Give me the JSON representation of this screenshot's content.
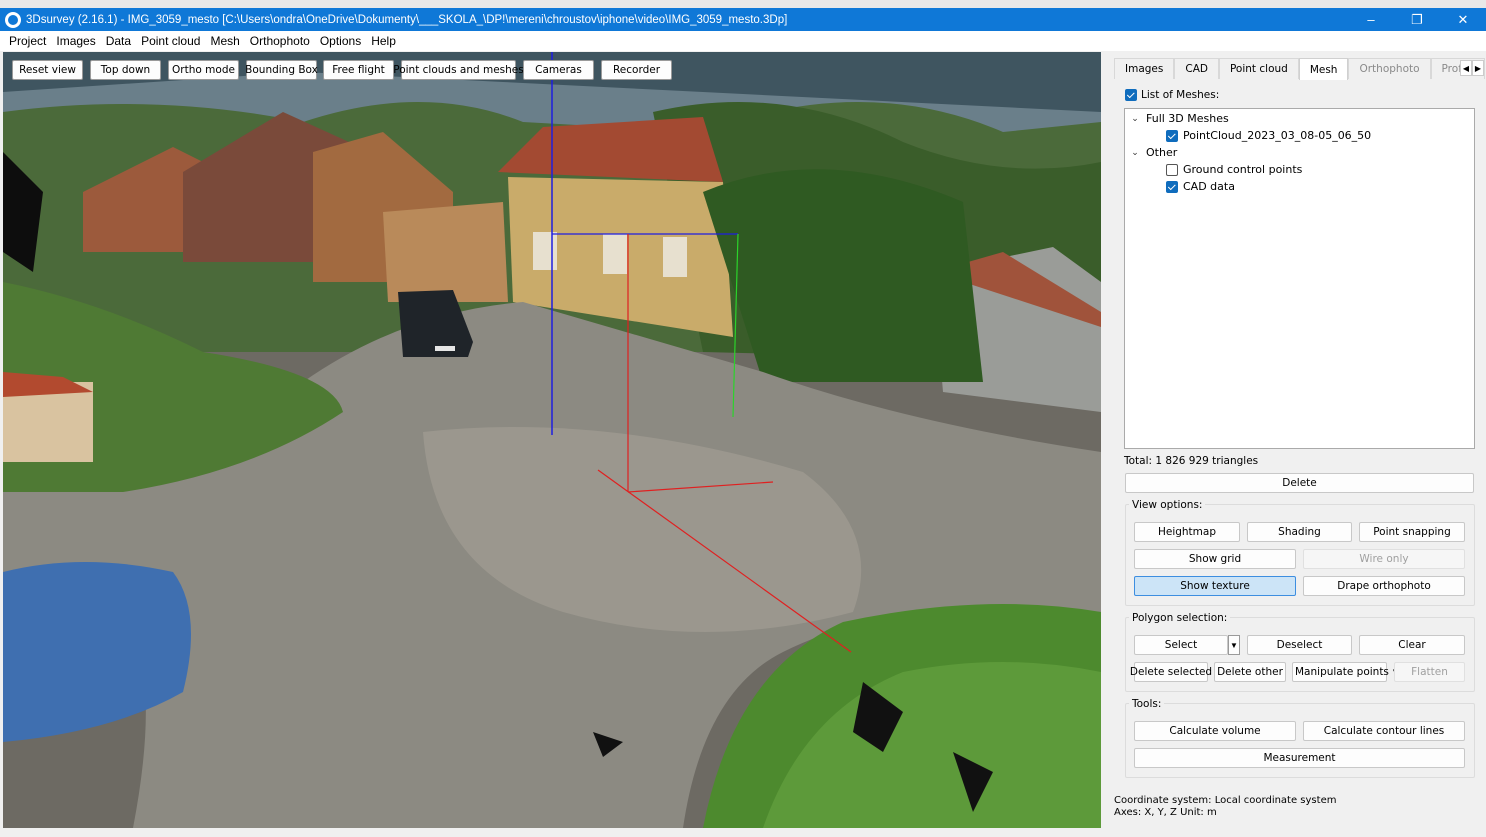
{
  "window": {
    "title": "3Dsurvey (2.16.1) - IMG_3059_mesto [C:\\Users\\ondra\\OneDrive\\Dokumenty\\___SKOLA_\\DP!\\mereni\\chroustov\\iphone\\video\\IMG_3059_mesto.3Dp]",
    "app_icon": "3dsurvey-logo-icon",
    "controls": {
      "minimize": "–",
      "restore": "❐",
      "close": "✕"
    }
  },
  "menu": [
    "Project",
    "Images",
    "Data",
    "Point cloud",
    "Mesh",
    "Orthophoto",
    "Options",
    "Help"
  ],
  "viewport": {
    "toolbar": [
      "Reset view",
      "Top down",
      "Ortho mode",
      "Bounding Box",
      "Free flight",
      "Point clouds and meshes",
      "Cameras",
      "Recorder"
    ]
  },
  "panel": {
    "tabs": [
      {
        "label": "Images",
        "active": false,
        "enabled": true
      },
      {
        "label": "CAD",
        "active": false,
        "enabled": true
      },
      {
        "label": "Point cloud",
        "active": false,
        "enabled": true
      },
      {
        "label": "Mesh",
        "active": true,
        "enabled": true
      },
      {
        "label": "Orthophoto",
        "active": false,
        "enabled": false
      },
      {
        "label": "Profile",
        "active": false,
        "enabled": false
      }
    ],
    "list_label": "List of Meshes:",
    "tree": {
      "group1": {
        "label": "Full 3D Meshes",
        "items": [
          {
            "label": "PointCloud_2023_03_08-05_06_50",
            "checked": true
          }
        ]
      },
      "group2": {
        "label": "Other",
        "items": [
          {
            "label": "Ground control points",
            "checked": false
          },
          {
            "label": "CAD data",
            "checked": true
          }
        ]
      }
    },
    "total": "Total: 1 826 929 triangles",
    "delete_label": "Delete",
    "view_options": {
      "title": "View options:",
      "heightmap": "Heightmap",
      "shading": "Shading",
      "point_snapping": "Point snapping",
      "show_grid": "Show grid",
      "wire_only": "Wire only",
      "show_texture": "Show texture",
      "drape_orthophoto": "Drape orthophoto"
    },
    "polygon_selection": {
      "title": "Polygon selection:",
      "select": "Select",
      "deselect": "Deselect",
      "clear": "Clear",
      "delete_selected": "Delete selected",
      "delete_other": "Delete other",
      "manipulate_points": "Manipulate points",
      "flatten": "Flatten"
    },
    "tools": {
      "title": "Tools:",
      "calculate_volume": "Calculate volume",
      "calculate_contour_lines": "Calculate contour lines",
      "measurement": "Measurement"
    },
    "coord_system": "Coordinate system: Local coordinate system",
    "axes": "Axes: X, Y, Z Unit: m"
  },
  "colors": {
    "titlebar": "#0f78d7",
    "checkbox": "#0f6cbd",
    "active_button": "#cce4f7"
  }
}
